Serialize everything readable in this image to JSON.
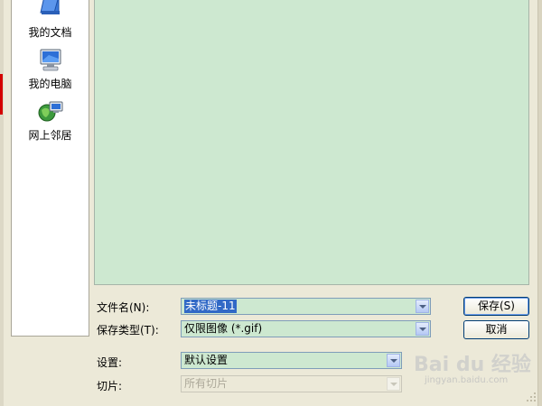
{
  "places_bar": {
    "items": [
      {
        "label": "我的文档",
        "icon": "my-documents-icon"
      },
      {
        "label": "我的电脑",
        "icon": "my-computer-icon"
      },
      {
        "label": "网上邻居",
        "icon": "network-places-icon"
      }
    ]
  },
  "form": {
    "filename": {
      "label": "文件名(N):",
      "value": "未标题-11"
    },
    "save_type": {
      "label": "保存类型(T):",
      "value": "仅限图像 (*.gif)"
    },
    "settings": {
      "label": "设置:",
      "value": "默认设置"
    },
    "slices": {
      "label": "切片:",
      "value": "所有切片"
    }
  },
  "buttons": {
    "save": "保存(S)",
    "cancel": "取消"
  },
  "watermark": {
    "text": "Bai du 经验",
    "sub": "jingyan.baidu.com"
  },
  "colors": {
    "preview_bg": "#cde8d0",
    "dialog_bg": "#ece9d8",
    "selection": "#3169c6"
  }
}
